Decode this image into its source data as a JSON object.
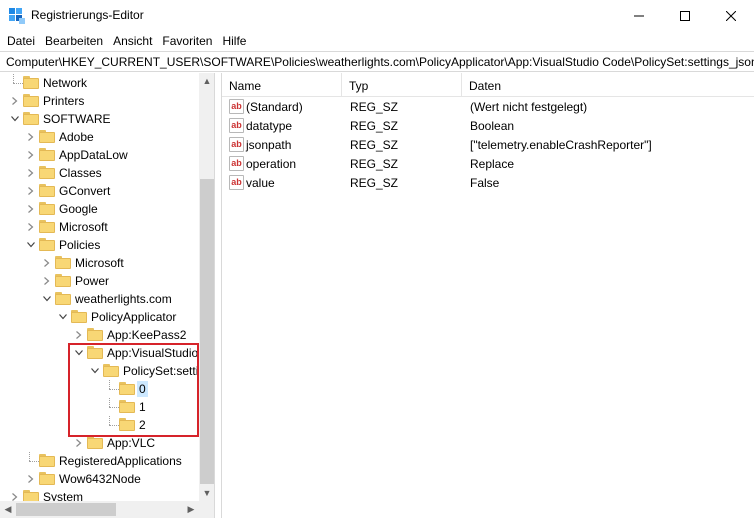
{
  "window": {
    "title": "Registrierungs-Editor",
    "minimize_glyph": "—",
    "maximize_glyph": "☐",
    "close_glyph": "✕"
  },
  "menu": [
    "Datei",
    "Bearbeiten",
    "Ansicht",
    "Favoriten",
    "Hilfe"
  ],
  "address": "Computer\\HKEY_CURRENT_USER\\SOFTWARE\\Policies\\weatherlights.com\\PolicyApplicator\\App:VisualStudio Code\\PolicySet:settings_json_N",
  "tree": [
    {
      "label": "Network",
      "depth": 1,
      "expander": "none"
    },
    {
      "label": "Printers",
      "depth": 1,
      "expander": "collapsed"
    },
    {
      "label": "SOFTWARE",
      "depth": 1,
      "expander": "expanded"
    },
    {
      "label": "Adobe",
      "depth": 2,
      "expander": "collapsed"
    },
    {
      "label": "AppDataLow",
      "depth": 2,
      "expander": "collapsed"
    },
    {
      "label": "Classes",
      "depth": 2,
      "expander": "collapsed"
    },
    {
      "label": "GConvert",
      "depth": 2,
      "expander": "collapsed"
    },
    {
      "label": "Google",
      "depth": 2,
      "expander": "collapsed"
    },
    {
      "label": "Microsoft",
      "depth": 2,
      "expander": "collapsed"
    },
    {
      "label": "Policies",
      "depth": 2,
      "expander": "expanded"
    },
    {
      "label": "Microsoft",
      "depth": 3,
      "expander": "collapsed"
    },
    {
      "label": "Power",
      "depth": 3,
      "expander": "collapsed"
    },
    {
      "label": "weatherlights.com",
      "depth": 3,
      "expander": "expanded"
    },
    {
      "label": "PolicyApplicator",
      "depth": 4,
      "expander": "expanded"
    },
    {
      "label": "App:KeePass2",
      "depth": 5,
      "expander": "collapsed"
    },
    {
      "label": "App:VisualStudio",
      "depth": 5,
      "expander": "expanded"
    },
    {
      "label": "PolicySet:settin",
      "depth": 6,
      "expander": "expanded"
    },
    {
      "label": "0",
      "depth": 7,
      "expander": "none",
      "selected": true
    },
    {
      "label": "1",
      "depth": 7,
      "expander": "none"
    },
    {
      "label": "2",
      "depth": 7,
      "expander": "none"
    },
    {
      "label": "App:VLC",
      "depth": 5,
      "expander": "collapsed"
    },
    {
      "label": "RegisteredApplications",
      "depth": 2,
      "expander": "none"
    },
    {
      "label": "Wow6432Node",
      "depth": 2,
      "expander": "collapsed"
    },
    {
      "label": "System",
      "depth": 1,
      "expander": "collapsed"
    }
  ],
  "list": {
    "columns": [
      "Name",
      "Typ",
      "Daten"
    ],
    "icon_text": "ab",
    "rows": [
      {
        "name": "(Standard)",
        "type": "REG_SZ",
        "data": "(Wert nicht festgelegt)"
      },
      {
        "name": "datatype",
        "type": "REG_SZ",
        "data": "Boolean"
      },
      {
        "name": "jsonpath",
        "type": "REG_SZ",
        "data": "[\"telemetry.enableCrashReporter\"]"
      },
      {
        "name": "operation",
        "type": "REG_SZ",
        "data": "Replace"
      },
      {
        "name": "value",
        "type": "REG_SZ",
        "data": "False"
      }
    ]
  },
  "scroll": {
    "up": "▲",
    "down": "▼",
    "left": "◀",
    "right": "▶"
  },
  "colors": {
    "highlight_box": "#d6232a",
    "selection": "#cce8ff",
    "folder": "#f8d775"
  }
}
